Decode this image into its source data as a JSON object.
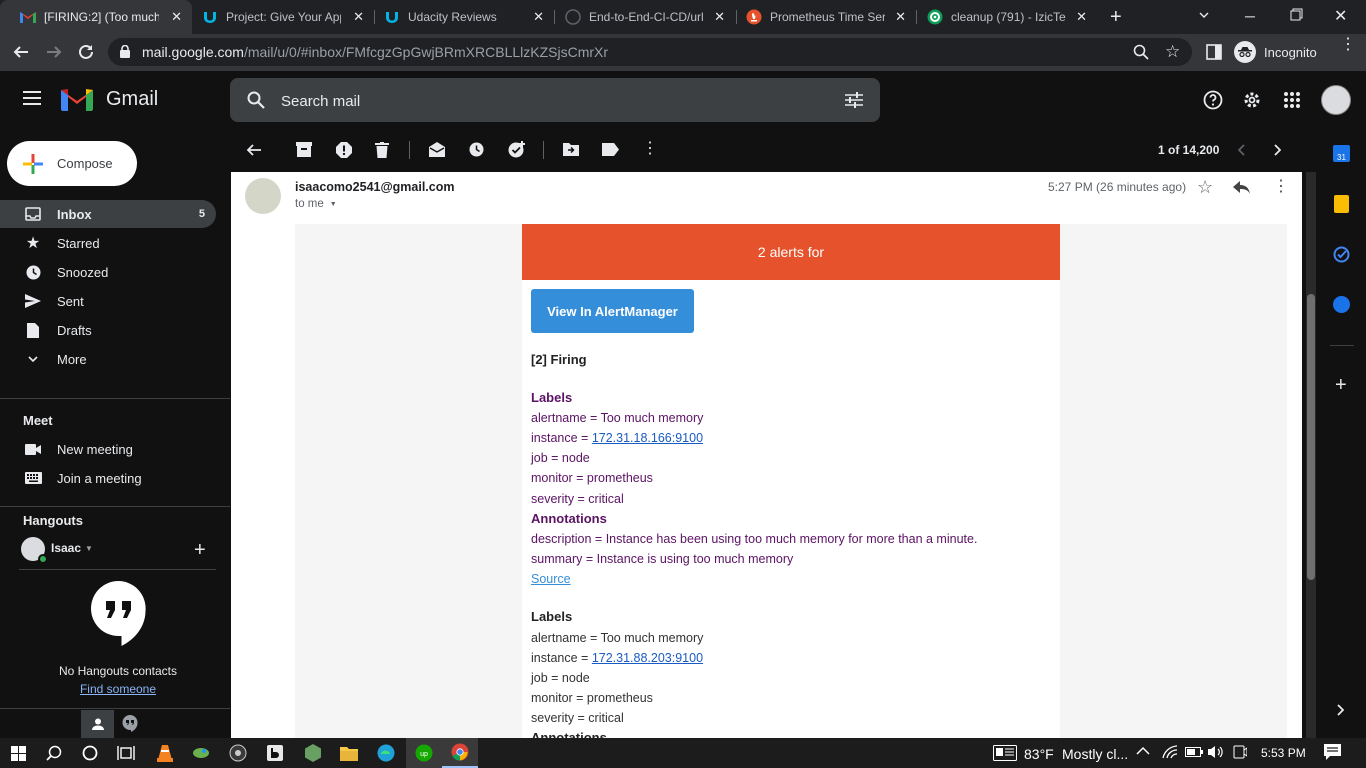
{
  "browser": {
    "tabs": [
      {
        "title": "[FIRING:2] (Too much",
        "icon": "gmail-icon",
        "active": true
      },
      {
        "title": "Project: Give Your App",
        "icon": "udacity-icon"
      },
      {
        "title": "Udacity Reviews",
        "icon": "udacity-icon"
      },
      {
        "title": "End-to-End-CI-CD/url",
        "icon": "github-icon"
      },
      {
        "title": "Prometheus Time Seri",
        "icon": "prometheus-icon"
      },
      {
        "title": "cleanup (791) - IzicTe",
        "icon": "circleci-icon"
      }
    ],
    "url_host": "mail.google.com",
    "url_path": "/mail/u/0/#inbox/FMfcgzGpGwjBRmXRCBLLlzKZSjsCmrXr",
    "profile_label": "Incognito"
  },
  "gmail": {
    "logo_text": "Gmail",
    "search_placeholder": "Search mail",
    "compose_label": "Compose",
    "nav": [
      {
        "label": "Inbox",
        "count": "5",
        "icon": "inbox-icon"
      },
      {
        "label": "Starred",
        "count": "",
        "icon": "star-icon"
      },
      {
        "label": "Snoozed",
        "count": "",
        "icon": "clock-icon"
      },
      {
        "label": "Sent",
        "count": "",
        "icon": "send-icon"
      },
      {
        "label": "Drafts",
        "count": "",
        "icon": "draft-icon"
      },
      {
        "label": "More",
        "count": "",
        "icon": "chevron-down-icon"
      }
    ],
    "meet": {
      "heading": "Meet",
      "new_meeting": "New meeting",
      "join_meeting": "Join a meeting"
    },
    "hangouts": {
      "heading": "Hangouts",
      "user": "Isaac",
      "empty_text": "No Hangouts contacts",
      "find_link": "Find someone"
    },
    "pagination": "1 of 14,200"
  },
  "email": {
    "sender": "isaacomo2541@gmail.com",
    "recipient": "to me",
    "time": "5:27 PM (26 minutes ago)",
    "banner": "2 alerts for",
    "button": "View In AlertManager",
    "firing": "[2] Firing",
    "alerts": [
      {
        "labels_heading": "Labels",
        "alertname": "alertname = Too much memory",
        "instance_prefix": "instance = ",
        "instance": "172.31.18.166:9100",
        "job": "job = node",
        "monitor": "monitor = prometheus",
        "severity": "severity = critical",
        "annotations_heading": "Annotations",
        "description": "description = Instance has been using too much memory for more than a minute.",
        "summary": "summary = Instance is using too much memory",
        "source": "Source"
      },
      {
        "labels_heading": "Labels",
        "alertname": "alertname = Too much memory",
        "instance_prefix": "instance = ",
        "instance": "172.31.88.203:9100",
        "job": "job = node",
        "monitor": "monitor = prometheus",
        "severity": "severity = critical",
        "annotations_heading": "Annotations"
      }
    ]
  },
  "taskbar": {
    "temperature": "83°F",
    "weather": "Mostly cl...",
    "time": "5:53 PM"
  },
  "colors": {
    "alert_orange": "#e6522c",
    "am_blue": "#348eda",
    "label_purple": "#5b1364"
  }
}
